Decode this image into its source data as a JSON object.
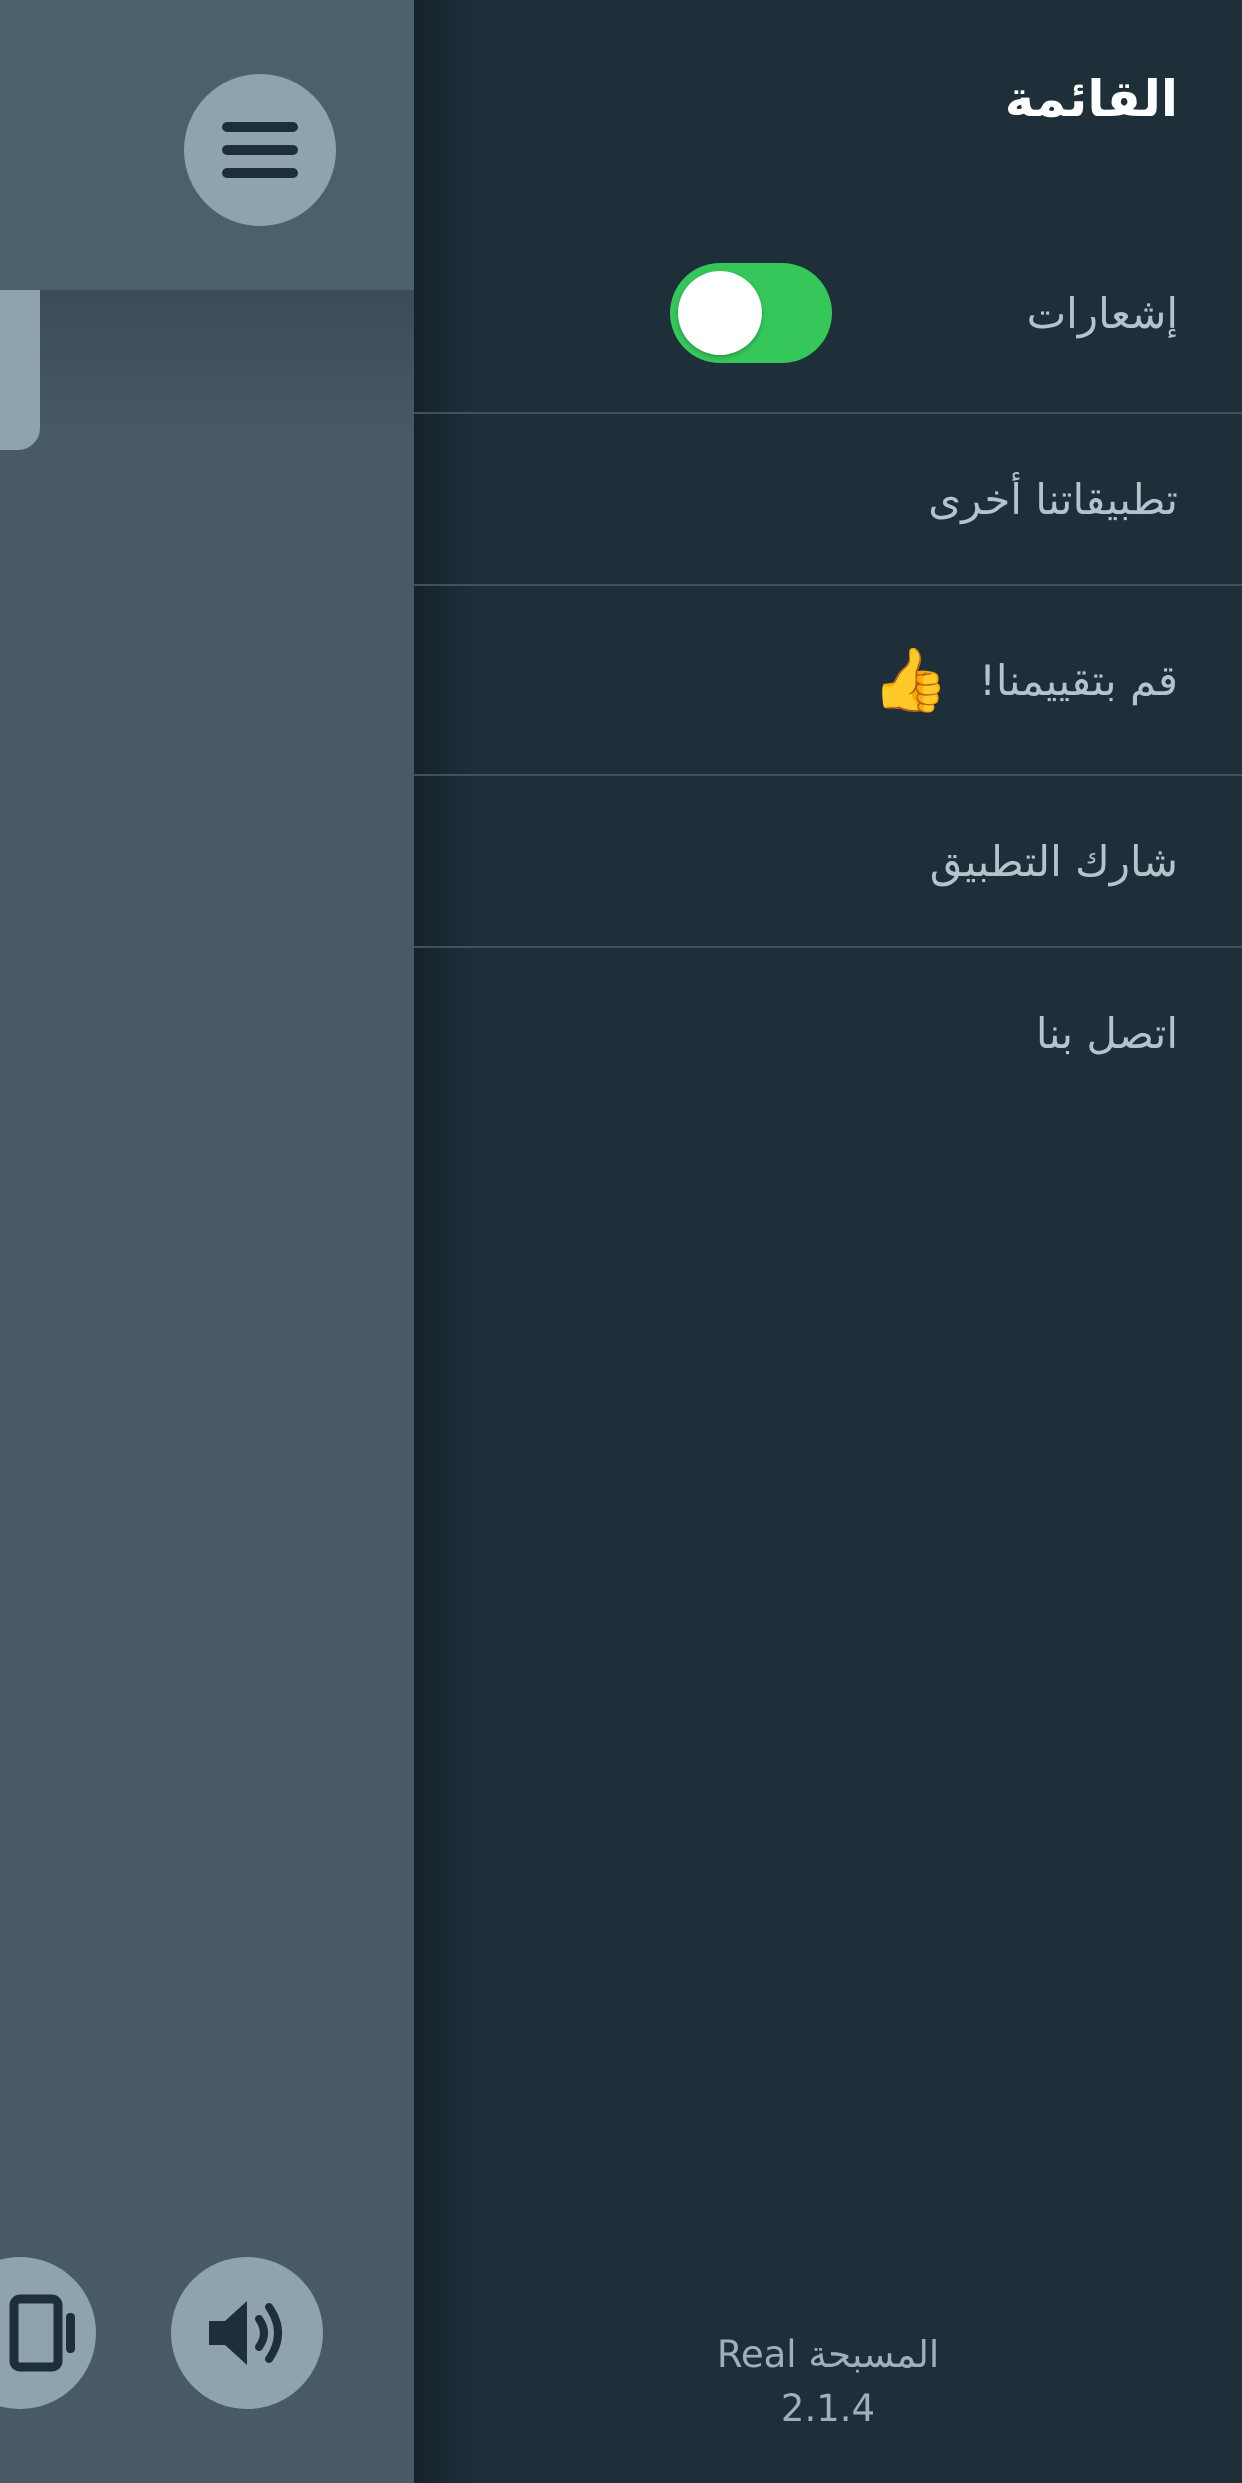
{
  "drawer": {
    "title": "القائمة",
    "items": [
      {
        "label": "إشعارات",
        "toggle_on": true
      },
      {
        "label": "تطبيقاتنا أخرى"
      },
      {
        "label": "قم بتقييمنا!",
        "emoji": "👍"
      },
      {
        "label": "شارك التطبيق"
      },
      {
        "label": "اتصل بنا"
      }
    ],
    "footer": {
      "app_name": "المسبحة Real",
      "version": "2.1.4"
    }
  },
  "colors": {
    "drawer_bg": "#1e2f3a",
    "toggle_on": "#35c759",
    "background_panel": "#485a66",
    "button_bg": "#8fa3ae"
  },
  "icons": {
    "menu": "hamburger-menu-icon",
    "sound": "speaker-icon",
    "device": "device-icon"
  }
}
